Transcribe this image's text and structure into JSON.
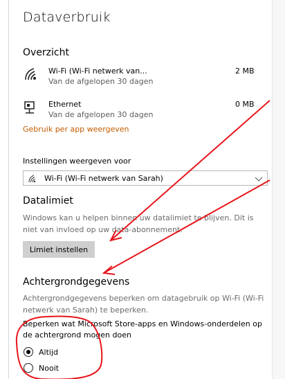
{
  "page": {
    "title": "Dataverbruik"
  },
  "overview": {
    "heading": "Overzicht",
    "items": [
      {
        "name": "Wi-Fi (Wi-Fi netwerk van...",
        "period": "Van de afgelopen 30 dagen",
        "usage": "2 MB",
        "icon": "wifi-icon"
      },
      {
        "name": "Ethernet",
        "period": "Van de afgelopen 30 dagen",
        "usage": "0 MB",
        "icon": "ethernet-icon"
      }
    ],
    "per_app_link": "Gebruik per app weergeven"
  },
  "settings_for": {
    "label": "Instellingen weergeven voor",
    "selected": "Wi-Fi (Wi-Fi netwerk van Sarah)"
  },
  "data_limit": {
    "heading": "Datalimiet",
    "description": "Windows kan u helpen binnen uw datalimiet te blijven. Dit is niet van invloed op uw data-abonnement.",
    "button": "Limiet instellen"
  },
  "background": {
    "heading": "Achtergrondgegevens",
    "description": "Achtergrondgegevens beperken om datagebruik op Wi-Fi (Wi-Fi netwerk van Sarah) te beperken.",
    "question": "Beperken wat Microsoft Store-apps en Windows-onderdelen op de achtergrond mogen doen",
    "options": [
      {
        "label": "Altijd",
        "selected": true
      },
      {
        "label": "Nooit",
        "selected": false
      }
    ]
  },
  "colors": {
    "accent_link": "#c35a00",
    "annotation": "#e8141b"
  }
}
